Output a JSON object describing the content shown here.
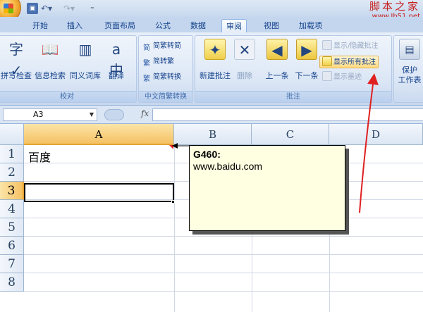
{
  "watermark": {
    "site_name": "脚本之家",
    "site_url": "www.Jb51.net"
  },
  "tabs": [
    "开始",
    "插入",
    "页面布局",
    "公式",
    "数据",
    "审阅",
    "视图",
    "加载项"
  ],
  "active_tab": "审阅",
  "ribbon": {
    "proofing": {
      "label": "校对",
      "spell_check": "拼写检查",
      "research": "信息检索",
      "thesaurus": "同义词库",
      "translate": "翻译"
    },
    "chinese_conversion": {
      "label": "中文简繁转换",
      "to_simplified": "简繁转简",
      "to_traditional": "简转繁",
      "convert": "简繁转换"
    },
    "comments": {
      "label": "批注",
      "new_comment": "新建批注",
      "delete": "删除",
      "previous": "上一条",
      "next": "下一条",
      "show_hide": "显示/隐藏批注",
      "show_all": "显示所有批注",
      "show_ink": "显示墨迹"
    },
    "changes": {
      "protect_line1": "保护",
      "protect_line2": "工作表"
    }
  },
  "formula_bar": {
    "name_box": "A3",
    "fx": "fx",
    "value": ""
  },
  "sheet": {
    "columns": [
      "A",
      "B",
      "C",
      "D"
    ],
    "rows": [
      "1",
      "2",
      "3",
      "4",
      "5",
      "6",
      "7",
      "8"
    ],
    "cells": {
      "A1": "百度"
    },
    "selected_cell": "A3"
  },
  "comment": {
    "author": "G460:",
    "text": "www.baidu.com"
  },
  "colors": {
    "annotation_arrow": "#e02020",
    "comment_bg": "#ffffe1",
    "selection_header": "#f5c163"
  }
}
